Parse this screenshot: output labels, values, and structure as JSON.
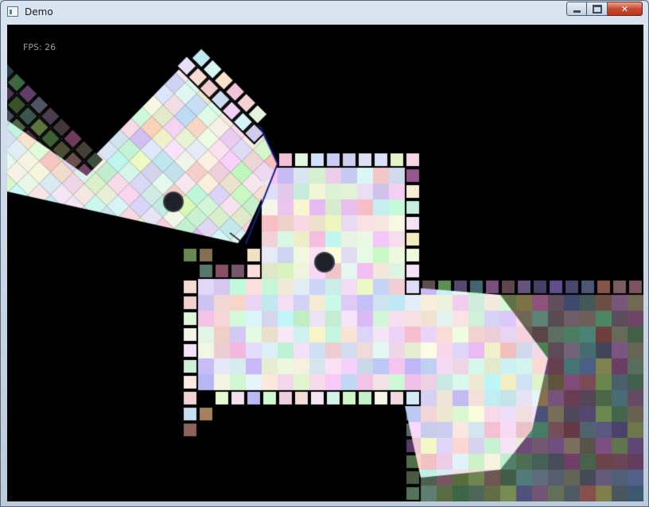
{
  "window": {
    "title": "Demo",
    "app_icon": "window-app-icon",
    "buttons": {
      "minimize": "minimize-icon",
      "maximize": "maximize-icon",
      "close": "close-icon"
    }
  },
  "hud": {
    "fps_text": "FPS: 26"
  },
  "scene": {
    "background": "#000000",
    "light_cone_edge_color": "#1a1f8c",
    "entity_color": "#1e2228",
    "entity_outline": "#3a3f47"
  }
}
